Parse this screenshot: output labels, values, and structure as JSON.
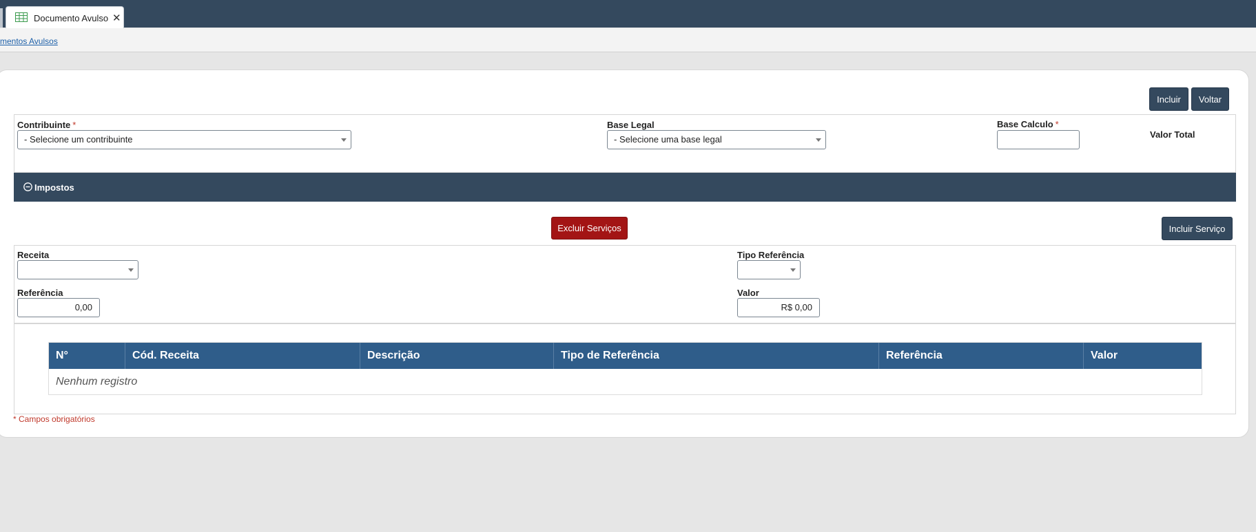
{
  "tab": {
    "label": "Documento Avulso",
    "icon": "spreadsheet-icon"
  },
  "breadcrumb": {
    "link": "mentos Avulsos"
  },
  "toolbar": {
    "incluir": "Incluir",
    "voltar": "Voltar"
  },
  "form": {
    "contribuinte_label": "Contribuinte",
    "contribuinte_value": "- Selecione um contribuinte",
    "base_legal_label": "Base Legal",
    "base_legal_value": "- Selecione uma base legal",
    "base_calculo_label": "Base Calculo",
    "base_calculo_value": "",
    "valor_total_label": "Valor Total",
    "required_mark": "*"
  },
  "impostos": {
    "title": "Impostos",
    "excluir_btn": "Excluir Serviços",
    "incluir_btn": "Incluir Serviço",
    "receita_label": "Receita",
    "receita_value": "",
    "tipo_referencia_label": "Tipo Referência",
    "tipo_referencia_value": "",
    "referencia_label": "Referência",
    "referencia_value": "0,00",
    "valor_label": "Valor",
    "valor_value": "R$ 0,00"
  },
  "table": {
    "columns": [
      "N°",
      "Cód. Receita",
      "Descrição",
      "Tipo de Referência",
      "Referência",
      "Valor"
    ],
    "empty_text": "Nenhum registro"
  },
  "footnote": "* Campos obrigatórios",
  "colors": {
    "header": "#34495e",
    "table_header": "#2f5d8a",
    "danger": "#a31515",
    "required": "#c0392b"
  }
}
